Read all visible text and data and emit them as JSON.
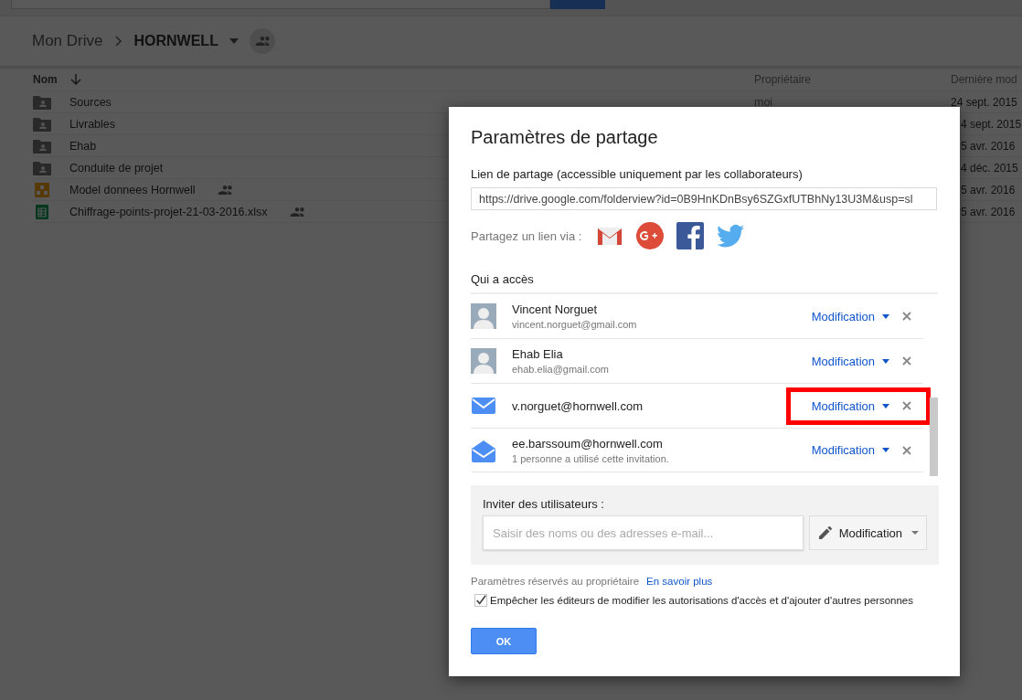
{
  "breadcrumb": {
    "parent": "Mon Drive",
    "current": "HORNWELL"
  },
  "table": {
    "columns": [
      {
        "label": "Nom",
        "sorted": true
      },
      {
        "label": "Propriétaire",
        "sorted": false
      },
      {
        "label": "Dernière mod",
        "sorted": false
      }
    ],
    "rows": [
      {
        "kind": "folder",
        "name": "Sources",
        "shared": false,
        "owner": "moi",
        "modified": "24 sept. 2015",
        "covered": false
      },
      {
        "kind": "folder",
        "name": "Livrables",
        "shared": false,
        "modified": "4 sept. 2015",
        "covered": true
      },
      {
        "kind": "folder",
        "name": "Ehab",
        "shared": false,
        "modified": "5 avr. 2016",
        "covered": true
      },
      {
        "kind": "folder",
        "name": "Conduite de projet",
        "shared": false,
        "modified": "4 déc. 2015",
        "covered": true
      },
      {
        "kind": "drawing",
        "name": "Model donnees Hornwell",
        "shared": true,
        "modified": "5 avr. 2016",
        "covered": true
      },
      {
        "kind": "sheet",
        "name": "Chiffrage-points-projet-21-03-2016.xlsx",
        "shared": true,
        "modified": "5 avr. 2016",
        "covered": true
      }
    ]
  },
  "dialog": {
    "title": "Paramètres de partage",
    "link_label": "Lien de partage (accessible uniquement par les collaborateurs)",
    "link_value": "https://drive.google.com/folderview?id=0B9HnKDnBsy6SZGxfUTBhNy13U3M&usp=sl",
    "share_via": "Partagez un lien via :",
    "share_targets": [
      {
        "kind": "gmail"
      },
      {
        "kind": "gplus"
      },
      {
        "kind": "facebook"
      },
      {
        "kind": "twitter"
      }
    ],
    "access_heading": "Qui a accès",
    "members": [
      {
        "kind": "person",
        "name": "Vincent Norguet",
        "detail": "vincent.norguet@gmail.com",
        "role": "Modification",
        "highlighted": false
      },
      {
        "kind": "person",
        "name": "Ehab Elia",
        "detail": "ehab.elia@gmail.com",
        "role": "Modification",
        "highlighted": false
      },
      {
        "kind": "email",
        "name": "v.norguet@hornwell.com",
        "role": "Modification",
        "highlighted": true
      },
      {
        "kind": "invitation",
        "name": "ee.barssoum@hornwell.com",
        "detail": "1 personne a utilisé cette invitation.",
        "role": "Modification",
        "highlighted": false
      }
    ],
    "invite": {
      "label": "Inviter des utilisateurs :",
      "placeholder": "Saisir des noms ou des adresses e-mail...",
      "role": "Modification"
    },
    "owner_settings": "Paramètres réservés au propriétaire",
    "learn_more": "En savoir plus",
    "prevent_editors": {
      "label": "Empêcher les éditeurs de modifier les autorisations d'accès et d'ajouter d'autres personnes",
      "checked": true
    },
    "ok": "OK"
  }
}
